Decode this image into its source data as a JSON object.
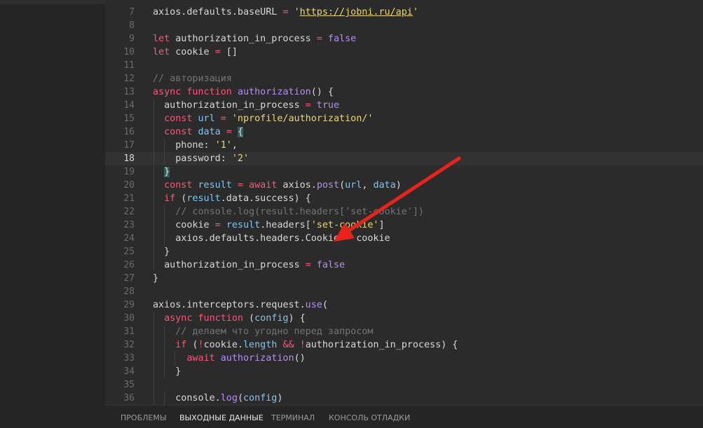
{
  "colors": {
    "editor_background": "#2b2b2b",
    "keyword": "#f25a7a",
    "string": "#e8d77a",
    "comment": "#747474",
    "arrow": "#e8231b"
  },
  "editor": {
    "current_line": "18",
    "lines": [
      {
        "n": "7",
        "ind": [],
        "tk": [
          [
            "",
            "axios.defaults.baseURL "
          ],
          [
            "op",
            "="
          ],
          [
            "",
            " "
          ],
          [
            "str",
            "'"
          ],
          [
            "url",
            "https://jobni.ru/api"
          ],
          [
            "str",
            "'"
          ]
        ]
      },
      {
        "n": "8",
        "ind": [],
        "tk": []
      },
      {
        "n": "9",
        "ind": [],
        "tk": [
          [
            "kw",
            "let"
          ],
          [
            "",
            " authorization_in_process "
          ],
          [
            "op",
            "="
          ],
          [
            "",
            " "
          ],
          [
            "bool",
            "false"
          ]
        ]
      },
      {
        "n": "10",
        "ind": [],
        "tk": [
          [
            "kw",
            "let"
          ],
          [
            "",
            " cookie "
          ],
          [
            "op",
            "="
          ],
          [
            "",
            " []"
          ]
        ]
      },
      {
        "n": "11",
        "ind": [],
        "tk": []
      },
      {
        "n": "12",
        "ind": [],
        "tk": [
          [
            "cmt",
            "// авторизация"
          ]
        ]
      },
      {
        "n": "13",
        "ind": [],
        "tk": [
          [
            "kw",
            "async"
          ],
          [
            "",
            " "
          ],
          [
            "kw",
            "function"
          ],
          [
            "",
            " "
          ],
          [
            "fn",
            "authorization"
          ],
          [
            "",
            "() {"
          ]
        ]
      },
      {
        "n": "14",
        "ind": [
          1
        ],
        "tk": [
          [
            "",
            "  authorization_in_process "
          ],
          [
            "op",
            "="
          ],
          [
            "",
            " "
          ],
          [
            "bool",
            "true"
          ]
        ]
      },
      {
        "n": "15",
        "ind": [
          1
        ],
        "tk": [
          [
            "",
            "  "
          ],
          [
            "kw",
            "const"
          ],
          [
            "",
            " "
          ],
          [
            "param",
            "url"
          ],
          [
            "",
            " "
          ],
          [
            "op",
            "="
          ],
          [
            "",
            " "
          ],
          [
            "str",
            "'nprofile/authorization/'"
          ]
        ]
      },
      {
        "n": "16",
        "ind": [
          1
        ],
        "tk": [
          [
            "",
            "  "
          ],
          [
            "kw",
            "const"
          ],
          [
            "",
            " "
          ],
          [
            "param",
            "data"
          ],
          [
            "",
            " "
          ],
          [
            "op",
            "="
          ],
          [
            "",
            " "
          ],
          [
            "brace-hl",
            "{"
          ]
        ]
      },
      {
        "n": "17",
        "ind": [
          1,
          2
        ],
        "tk": [
          [
            "",
            "    phone: "
          ],
          [
            "str",
            "'1'"
          ],
          [
            "",
            ","
          ]
        ]
      },
      {
        "n": "18",
        "ind": [
          1,
          2
        ],
        "tk": [
          [
            "",
            "    password: "
          ],
          [
            "str",
            "'2'"
          ]
        ]
      },
      {
        "n": "19",
        "ind": [
          1
        ],
        "tk": [
          [
            "",
            "  "
          ],
          [
            "brace-hl",
            "}"
          ]
        ]
      },
      {
        "n": "20",
        "ind": [
          1
        ],
        "tk": [
          [
            "",
            "  "
          ],
          [
            "kw",
            "const"
          ],
          [
            "",
            " "
          ],
          [
            "param",
            "result"
          ],
          [
            "",
            " "
          ],
          [
            "op",
            "="
          ],
          [
            "",
            " "
          ],
          [
            "kw",
            "await"
          ],
          [
            "",
            " axios."
          ],
          [
            "fn",
            "post"
          ],
          [
            "",
            "("
          ],
          [
            "param",
            "url"
          ],
          [
            "",
            ", "
          ],
          [
            "param",
            "data"
          ],
          [
            "",
            ")"
          ]
        ]
      },
      {
        "n": "21",
        "ind": [
          1
        ],
        "tk": [
          [
            "",
            "  "
          ],
          [
            "kw",
            "if"
          ],
          [
            "",
            " ("
          ],
          [
            "param",
            "result"
          ],
          [
            "",
            ".data.success) {"
          ]
        ]
      },
      {
        "n": "22",
        "ind": [
          1,
          2
        ],
        "tk": [
          [
            "",
            "    "
          ],
          [
            "cmt",
            "// console.log(result.headers['set-cookie'])"
          ]
        ]
      },
      {
        "n": "23",
        "ind": [
          1,
          2
        ],
        "tk": [
          [
            "",
            "    cookie "
          ],
          [
            "op",
            "="
          ],
          [
            "",
            " "
          ],
          [
            "param",
            "result"
          ],
          [
            "",
            ".headers["
          ],
          [
            "str",
            "'set-cookie'"
          ],
          [
            "",
            "]"
          ]
        ]
      },
      {
        "n": "24",
        "ind": [
          1,
          2
        ],
        "tk": [
          [
            "",
            "    axios.defaults.headers.Cookie "
          ],
          [
            "op",
            "="
          ],
          [
            "",
            " cookie"
          ]
        ]
      },
      {
        "n": "25",
        "ind": [
          1
        ],
        "tk": [
          [
            "",
            "  }"
          ]
        ]
      },
      {
        "n": "26",
        "ind": [
          1
        ],
        "tk": [
          [
            "",
            "  authorization_in_process "
          ],
          [
            "op",
            "="
          ],
          [
            "",
            " "
          ],
          [
            "bool",
            "false"
          ]
        ]
      },
      {
        "n": "27",
        "ind": [],
        "tk": [
          [
            "",
            "}"
          ]
        ]
      },
      {
        "n": "28",
        "ind": [],
        "tk": []
      },
      {
        "n": "29",
        "ind": [],
        "tk": [
          [
            "",
            "axios.interceptors.request."
          ],
          [
            "fn",
            "use"
          ],
          [
            "",
            "("
          ]
        ]
      },
      {
        "n": "30",
        "ind": [
          1
        ],
        "tk": [
          [
            "",
            "  "
          ],
          [
            "kw",
            "async"
          ],
          [
            "",
            " "
          ],
          [
            "kw",
            "function"
          ],
          [
            "",
            " ("
          ],
          [
            "param",
            "config"
          ],
          [
            "",
            ") {"
          ]
        ]
      },
      {
        "n": "31",
        "ind": [
          1,
          2
        ],
        "tk": [
          [
            "",
            "    "
          ],
          [
            "cmt",
            "// делаем что угодно перед запросом"
          ]
        ]
      },
      {
        "n": "32",
        "ind": [
          1,
          2
        ],
        "tk": [
          [
            "",
            "    "
          ],
          [
            "kw",
            "if"
          ],
          [
            "",
            " ("
          ],
          [
            "op",
            "!"
          ],
          [
            "",
            "cookie."
          ],
          [
            "param",
            "length"
          ],
          [
            "",
            " "
          ],
          [
            "op",
            "&&"
          ],
          [
            "",
            " "
          ],
          [
            "op",
            "!"
          ],
          [
            "",
            "authorization_in_process) {"
          ]
        ]
      },
      {
        "n": "33",
        "ind": [
          1,
          2,
          3
        ],
        "tk": [
          [
            "",
            "      "
          ],
          [
            "kw",
            "await"
          ],
          [
            "",
            " "
          ],
          [
            "fn",
            "authorization"
          ],
          [
            "",
            "()"
          ]
        ]
      },
      {
        "n": "34",
        "ind": [
          1,
          2
        ],
        "tk": [
          [
            "",
            "    }"
          ]
        ]
      },
      {
        "n": "35",
        "ind": [
          1
        ],
        "tk": []
      },
      {
        "n": "36",
        "ind": [
          1,
          2
        ],
        "tk": [
          [
            "",
            "    console."
          ],
          [
            "fn",
            "log"
          ],
          [
            "",
            "("
          ],
          [
            "param",
            "config"
          ],
          [
            "",
            ")"
          ]
        ]
      }
    ]
  },
  "bottom_panel": {
    "tabs": [
      {
        "label": "ПРОБЛЕМЫ",
        "active": false
      },
      {
        "label": "ВЫХОДНЫЕ ДАННЫЕ",
        "active": true
      },
      {
        "label": "ТЕРМИНАЛ",
        "active": false
      },
      {
        "label": "КОНСОЛЬ ОТЛАДКИ",
        "active": false
      }
    ]
  }
}
